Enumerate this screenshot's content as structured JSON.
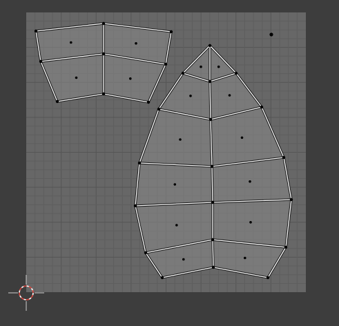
{
  "editor": {
    "name": "uv-editor",
    "colors": {
      "background": "#3d3d3d",
      "grid_area": "#676767",
      "grid_minor": "#5e5e5e",
      "grid_major": "#555555",
      "face_fill": "#8a8a8a",
      "edge_outer": "#1a1a1a",
      "edge_inner": "#ffffff",
      "vertex": "#000000",
      "face_dot": "#000000",
      "cursor_red": "#d9443c",
      "cursor_white": "#ffffff"
    },
    "icons": {
      "cursor": "2d-cursor-icon",
      "vertex": "uv-vertex-dot",
      "face_center": "face-center-dot",
      "loose_vertex": "loose-vertex-dot"
    },
    "islands": [
      {
        "name": "top-left-island",
        "faces": 4
      },
      {
        "name": "leaf-island",
        "faces": 12
      }
    ]
  }
}
